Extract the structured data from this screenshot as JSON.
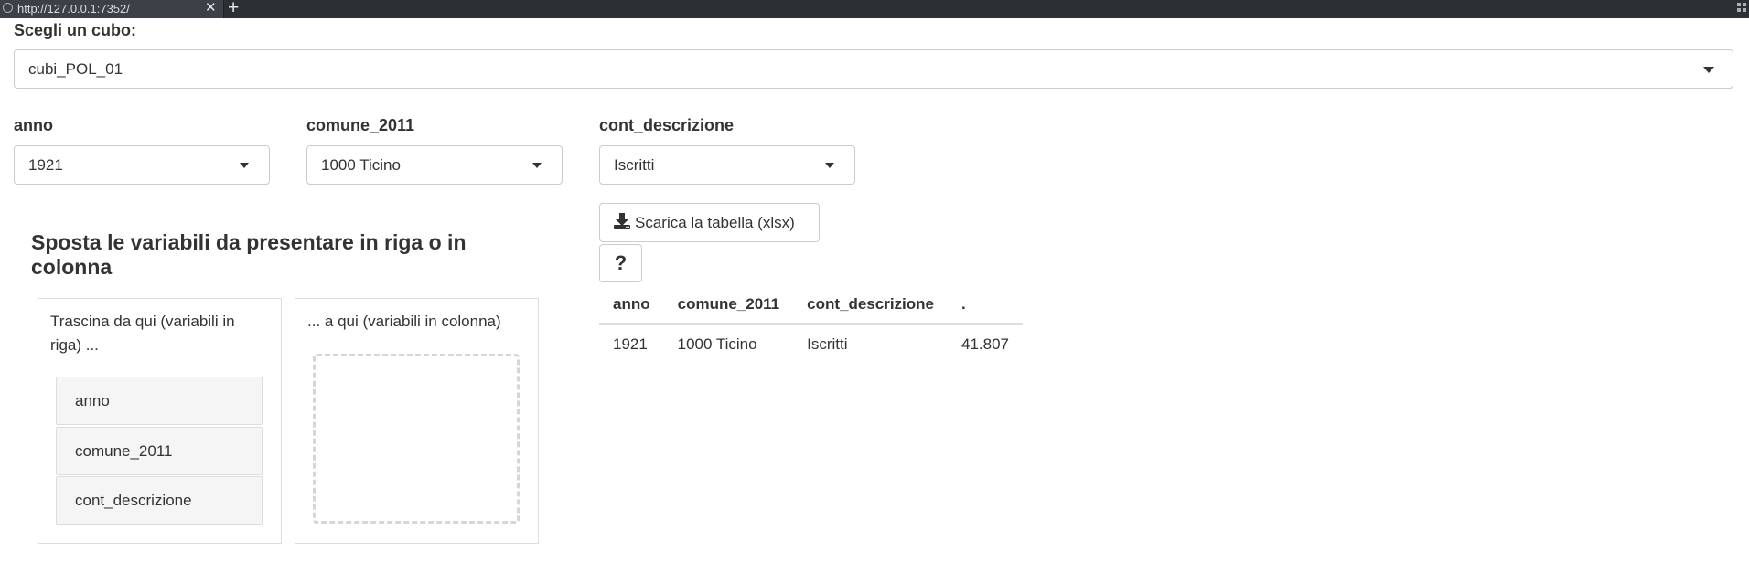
{
  "browser": {
    "tab_title": "http://127.0.0.1:7352/",
    "close_glyph": "✕",
    "new_tab_glyph": "+"
  },
  "cube_selector": {
    "label": "Scegli un cubo:",
    "value": "cubi_POL_01"
  },
  "filters": [
    {
      "label": "anno",
      "value": "1921"
    },
    {
      "label": "comune_2011",
      "value": "1000 Ticino"
    },
    {
      "label": "cont_descrizione",
      "value": "Iscritti"
    }
  ],
  "download_button": {
    "label": "Scarica la tabella (xlsx)",
    "icon": "download-icon"
  },
  "help_button": {
    "label": "?"
  },
  "pivot": {
    "heading": "Sposta le variabili da presentare in riga o in colonna",
    "rows_panel": {
      "title": "Trascina da qui (variabili in riga) ...",
      "items": [
        "anno",
        "comune_2011",
        "cont_descrizione"
      ]
    },
    "cols_panel": {
      "title": "... a qui (variabili in colonna)"
    }
  },
  "table": {
    "headers": [
      "anno",
      "comune_2011",
      "cont_descrizione",
      "."
    ],
    "rows": [
      [
        "1921",
        "1000 Ticino",
        "Iscritti",
        "41.807"
      ]
    ]
  }
}
